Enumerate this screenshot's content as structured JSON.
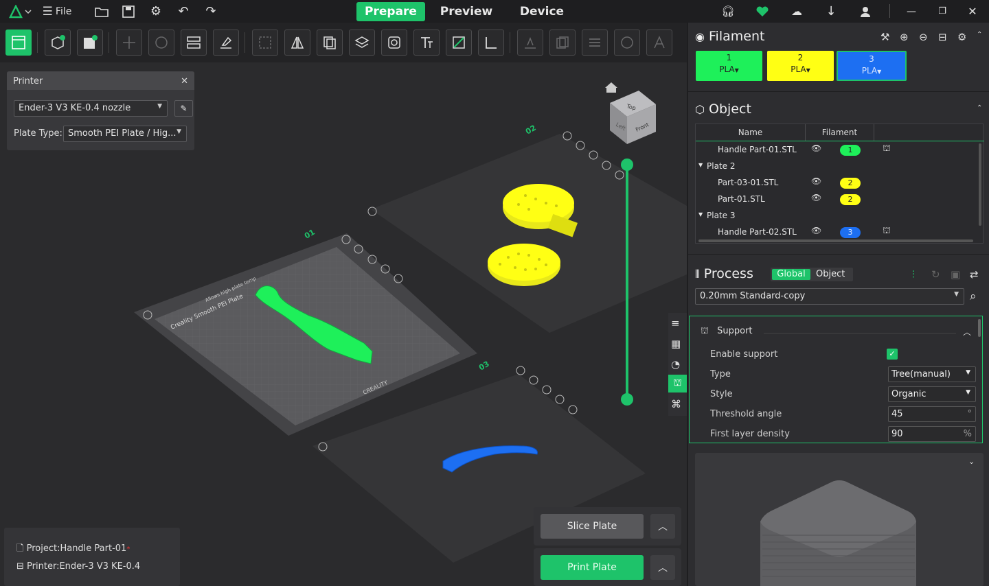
{
  "topbar": {
    "file_label": "File",
    "tabs": [
      "Prepare",
      "Preview",
      "Device"
    ],
    "active_tab": "Prepare"
  },
  "printer_panel": {
    "title": "Printer",
    "printer": "Ender-3 V3 KE-0.4 nozzle",
    "plate_type_label": "Plate Type:",
    "plate_type": "Smooth PEI Plate / Hig..."
  },
  "viewport": {
    "plates": [
      "01",
      "02",
      "03"
    ],
    "bed_text_1": "Creality Smooth PEI Plate",
    "bed_text_2": "CREALITY",
    "bed_text_3": "Allows high plate temp",
    "cube_faces": {
      "top": "Top",
      "front": "Front",
      "left": "Left"
    }
  },
  "filament": {
    "title": "Filament",
    "slots": [
      {
        "num": "1",
        "type": "PLA",
        "color": "#1ef05a"
      },
      {
        "num": "2",
        "type": "PLA",
        "color": "#ffff14"
      },
      {
        "num": "3",
        "type": "PLA",
        "color": "#1d6ff2"
      }
    ]
  },
  "object": {
    "title": "Object",
    "col_name": "Name",
    "col_filament": "Filament",
    "rows": [
      {
        "name": "Handle Part-01.STL",
        "filament": "1",
        "indent": 1,
        "support": true
      },
      {
        "name": "Plate 2",
        "group": true
      },
      {
        "name": "Part-03-01.STL",
        "filament": "2",
        "indent": 1
      },
      {
        "name": "Part-01.STL",
        "filament": "2",
        "indent": 1
      },
      {
        "name": "Plate 3",
        "group": true
      },
      {
        "name": "Handle Part-02.STL",
        "filament": "3",
        "indent": 1,
        "support": true
      }
    ]
  },
  "process": {
    "title": "Process",
    "tab_global": "Global",
    "tab_object": "Object",
    "preset": "0.20mm Standard-copy",
    "support_title": "Support",
    "settings": [
      {
        "label": "Enable support",
        "kind": "check",
        "value": "true"
      },
      {
        "label": "Type",
        "kind": "combo",
        "value": "Tree(manual)"
      },
      {
        "label": "Style",
        "kind": "combo",
        "value": "Organic"
      },
      {
        "label": "Threshold angle",
        "kind": "field",
        "value": "45",
        "unit": "°"
      },
      {
        "label": "First layer density",
        "kind": "field",
        "value": "90",
        "unit": "%"
      }
    ]
  },
  "actions": {
    "slice": "Slice Plate",
    "print": "Print Plate"
  },
  "status": {
    "project_label": "Project:",
    "project": "Handle Part-01",
    "printer_label": "Printer:",
    "printer": "Ender-3 V3 KE-0.4"
  },
  "colors": {
    "accent": "#1ec36a",
    "green_model": "#1ef05a",
    "yellow_model": "#ffff14",
    "blue_model": "#1d6ff2"
  }
}
